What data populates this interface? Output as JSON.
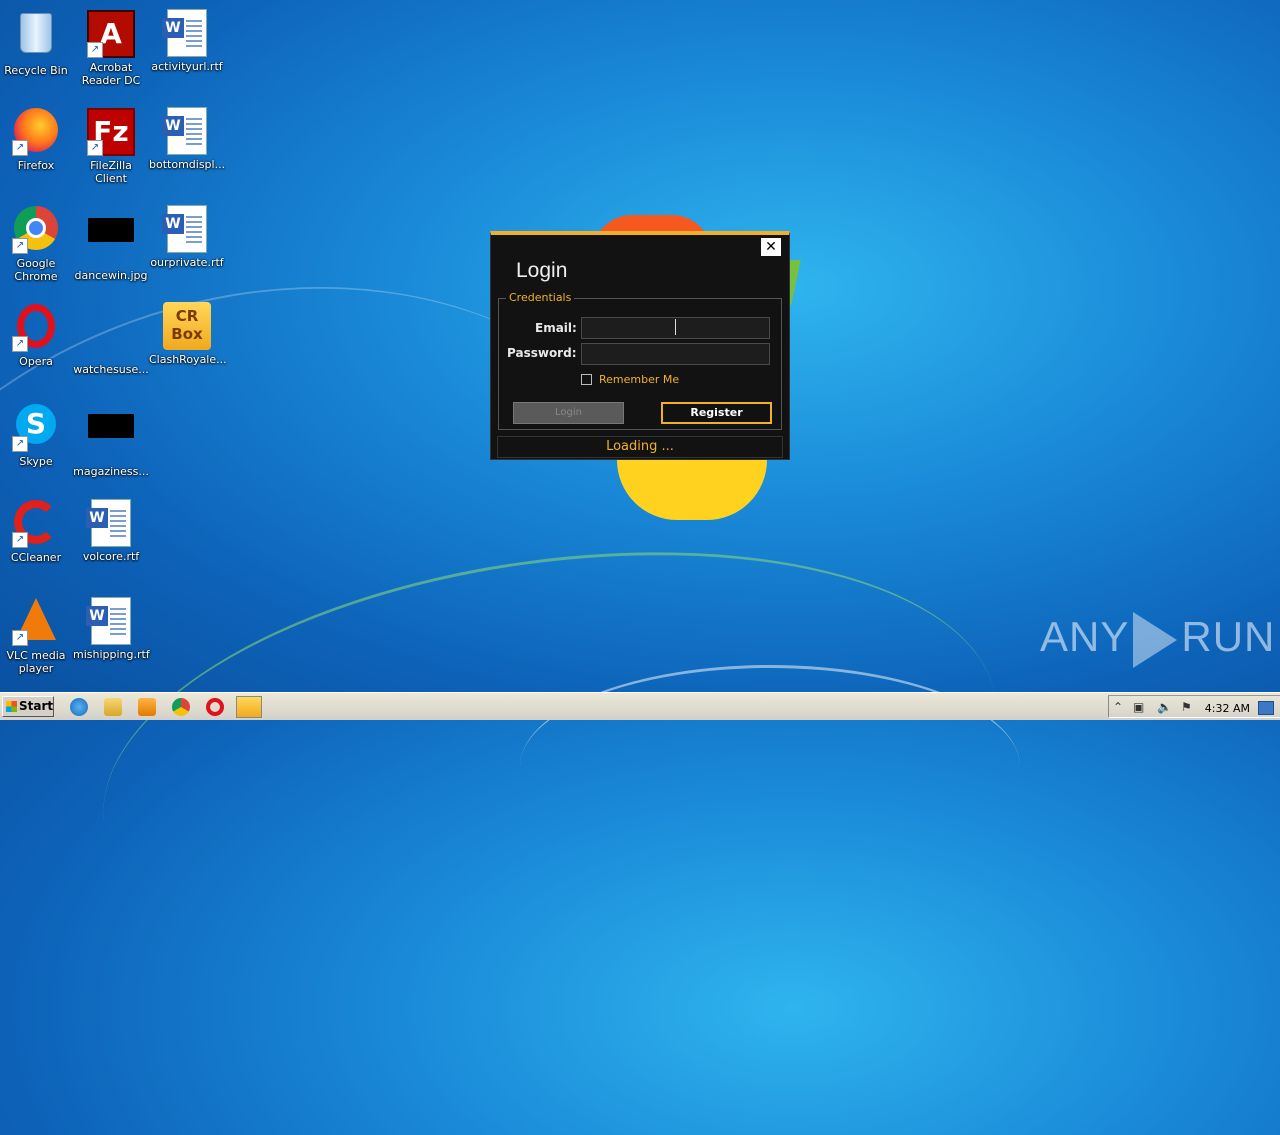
{
  "desktop": {
    "icons": [
      {
        "label": "Recycle Bin",
        "icon": "recycle-bin-icon"
      },
      {
        "label": "Acrobat Reader DC",
        "icon": "acrobat-icon"
      },
      {
        "label": "activityurl.rtf",
        "icon": "word-document-icon"
      },
      {
        "label": "Firefox",
        "icon": "firefox-icon"
      },
      {
        "label": "FileZilla Client",
        "icon": "filezilla-icon"
      },
      {
        "label": "bottomdispl...",
        "icon": "word-document-icon"
      },
      {
        "label": "Google Chrome",
        "icon": "chrome-icon"
      },
      {
        "label": "dancewin.jpg",
        "icon": "image-thumbnail-icon"
      },
      {
        "label": "ourprivate.rtf",
        "icon": "word-document-icon"
      },
      {
        "label": "Opera",
        "icon": "opera-icon"
      },
      {
        "label": "watchesuse...",
        "icon": "image-thumbnail-icon"
      },
      {
        "label": "ClashRoyale...",
        "icon": "clashroyale-icon"
      },
      {
        "label": "Skype",
        "icon": "skype-icon"
      },
      {
        "label": "magaziness...",
        "icon": "image-thumbnail-icon"
      },
      {
        "label": "CCleaner",
        "icon": "ccleaner-icon"
      },
      {
        "label": "volcore.rtf",
        "icon": "word-document-icon"
      },
      {
        "label": "VLC media player",
        "icon": "vlc-icon"
      },
      {
        "label": "mishipping.rtf",
        "icon": "word-document-icon"
      }
    ],
    "glyphs": {
      "shortcut": "↗",
      "acrobat": "A",
      "word": "W",
      "filezilla": "Fz",
      "skype": "S",
      "clash": "CR Box"
    }
  },
  "dialog": {
    "title": "Login",
    "close_glyph": "✕",
    "group_label": "Credentials",
    "email_label": "Email:",
    "email_value": "",
    "password_label": "Password:",
    "password_value": "",
    "remember_label": "Remember Me",
    "remember_checked": false,
    "login_button": "Login",
    "register_button": "Register",
    "status": "Loading ..."
  },
  "watermark": {
    "left": "ANY",
    "right": "RUN"
  },
  "taskbar": {
    "start_label": "Start",
    "pinned": [
      "internet-explorer-icon",
      "file-explorer-icon",
      "media-player-icon",
      "chrome-icon",
      "opera-icon",
      "clashroyale-icon"
    ],
    "clock": "4:32 AM",
    "tray_glyphs": [
      "⌃",
      "▣",
      "🔈",
      "⚑"
    ]
  },
  "colors": {
    "accent": "#f0b12a",
    "dialog_bg": "#121212"
  }
}
